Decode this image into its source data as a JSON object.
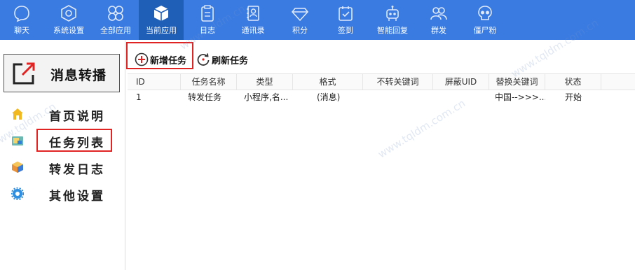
{
  "toolbar": {
    "items": [
      {
        "label": "聊天",
        "icon": "chat-bubble-icon"
      },
      {
        "label": "系统设置",
        "icon": "gear-hexagon-icon"
      },
      {
        "label": "全部应用",
        "icon": "four-circles-icon"
      },
      {
        "label": "当前应用",
        "icon": "cube-icon",
        "active": true
      },
      {
        "label": "日志",
        "icon": "clipboard-icon"
      },
      {
        "label": "通讯录",
        "icon": "contacts-book-icon"
      },
      {
        "label": "积分",
        "icon": "diamond-icon"
      },
      {
        "label": "签到",
        "icon": "calendar-check-icon"
      },
      {
        "label": "智能回复",
        "icon": "robot-icon"
      },
      {
        "label": "群发",
        "icon": "group-users-icon"
      },
      {
        "label": "僵尸粉",
        "icon": "skull-icon"
      }
    ],
    "bg_color": "#3a7be2",
    "active_color": "#1f5fb8"
  },
  "sidebar": {
    "app_title": "消息转播",
    "items": [
      {
        "label": "首页说明",
        "icon": "home-icon"
      },
      {
        "label": "任务列表",
        "icon": "task-folder-icon",
        "highlighted": true
      },
      {
        "label": "转发日志",
        "icon": "log-box-icon"
      },
      {
        "label": "其他设置",
        "icon": "settings-gear-icon"
      }
    ]
  },
  "actions": {
    "add_task": "新增任务",
    "refresh_task": "刷新任务"
  },
  "table": {
    "columns": [
      "ID",
      "任务名称",
      "类型",
      "格式",
      "不转关键词",
      "屏蔽UID",
      "替换关键词",
      "状态"
    ],
    "rows": [
      [
        "1",
        "转发任务",
        "小程序,名...",
        "(消息)",
        "",
        "",
        "中国-->>>...",
        "开始"
      ]
    ]
  },
  "highlight_color": "#e02424"
}
